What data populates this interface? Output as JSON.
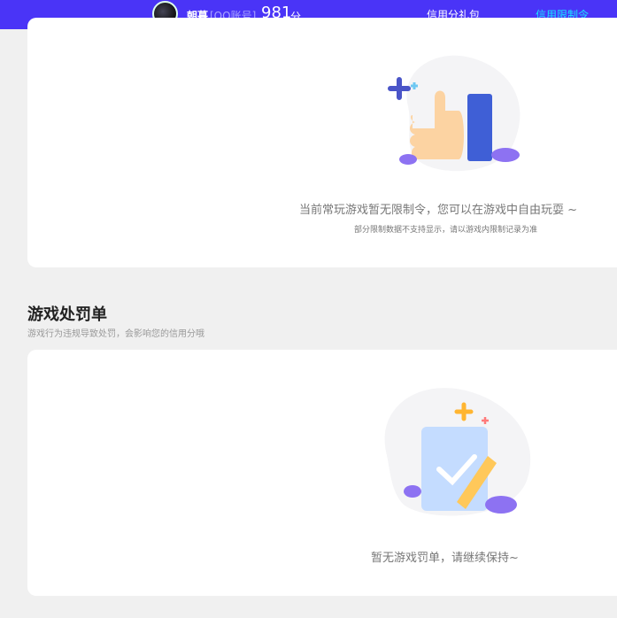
{
  "header": {
    "user_name": "朝暮",
    "account_type": "[QQ账号]",
    "score": "981",
    "score_unit": "分",
    "tabs": [
      {
        "label": "信用分礼包",
        "active": false
      },
      {
        "label": "信用限制令",
        "active": true
      }
    ]
  },
  "restriction": {
    "empty_message": "当前常玩游戏暂无限制令，您可以在游戏中自由玩耍 ~",
    "note": "部分限制数据不支持显示，请以游戏内限制记录为准"
  },
  "penalty": {
    "title": "游戏处罚单",
    "subtitle": "游戏行为违规导致处罚，会影响您的信用分哦",
    "empty_message": "暂无游戏罚单，请继续保持~"
  },
  "colors": {
    "header_bg": "#4a34f7",
    "active_tab": "#19e6ff"
  }
}
